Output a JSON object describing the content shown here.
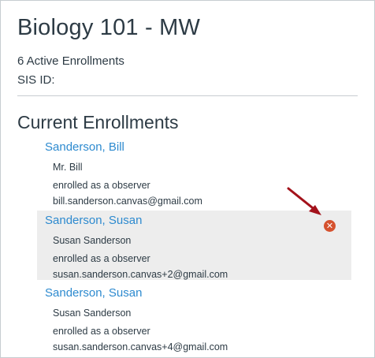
{
  "course": {
    "title": "Biology 101 - MW",
    "active_enrollments": "6 Active Enrollments",
    "sis_label": "SIS ID:"
  },
  "section_title": "Current Enrollments",
  "enrollments": [
    {
      "name": "Sanderson, Bill",
      "display_name": "Mr. Bill",
      "role": "enrolled as a observer",
      "email": "bill.sanderson.canvas@gmail.com"
    },
    {
      "name": "Sanderson, Susan",
      "display_name": "Susan Sanderson",
      "role": "enrolled as a observer",
      "email": "susan.sanderson.canvas+2@gmail.com",
      "remove_icon": "remove-icon"
    },
    {
      "name": "Sanderson, Susan",
      "display_name": "Susan Sanderson",
      "role": "enrolled as a observer",
      "email": "susan.sanderson.canvas+4@gmail.com"
    }
  ],
  "colors": {
    "link": "#2d8acf",
    "text": "#2d3b45",
    "highlight": "#ededed",
    "remove": "#d5522f",
    "arrow": "#a3121b"
  }
}
